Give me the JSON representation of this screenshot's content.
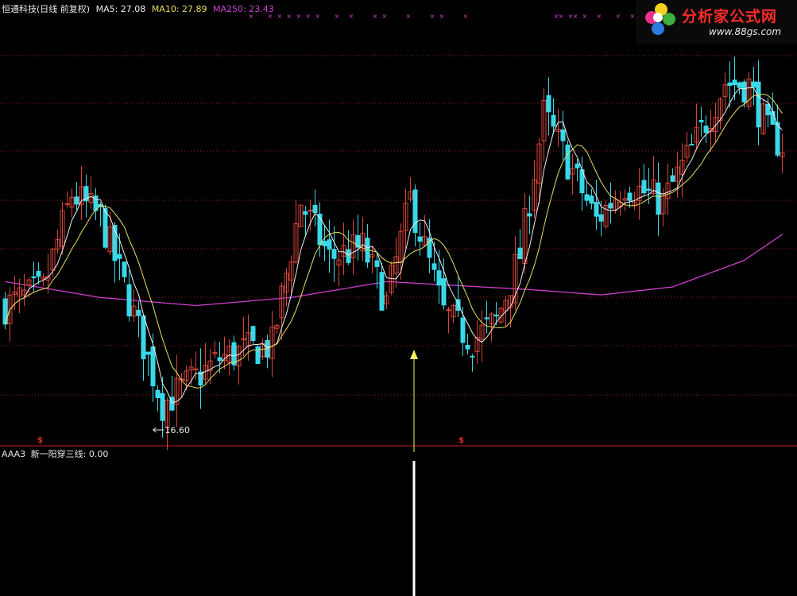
{
  "header": {
    "stock_title": "恒通科技(日线 前复权)",
    "ma5": "MA5: 27.08",
    "ma10": "MA10: 27.89",
    "ma250": "MA250: 23.43"
  },
  "indicator": {
    "name": "AAA3",
    "label": "新一阳穿三线: 0.00"
  },
  "watermark": {
    "brand": "分析家公式网",
    "url": "www.88gs.com"
  },
  "annotations": {
    "low_label": "16.60",
    "marker_glyph": "$"
  },
  "colors": {
    "background": "#000000",
    "up": "#d8453a",
    "down": "#38d8e8",
    "ma5": "#f0f0f0",
    "ma10": "#e8e060",
    "ma250": "#d040d0",
    "grid": "#9a1f1f",
    "title": "#e8e8e8",
    "signal": "#f0f060",
    "topmarks": "#d040d0"
  },
  "chart_data": [
    {
      "type": "candlestick",
      "title": "恒通科技(日线 前复权)",
      "series": [
        {
          "name": "MA5",
          "last": 27.08
        },
        {
          "name": "MA10",
          "last": 27.89
        },
        {
          "name": "MA250",
          "last": 23.43
        }
      ],
      "annotations": [
        {
          "text": "16.60",
          "kind": "period-low"
        }
      ],
      "ylim": [
        15.5,
        31.5
      ],
      "grid": true,
      "candles_approx": 164,
      "price_path_anchors": [
        [
          0,
          20.6
        ],
        [
          8,
          21.2
        ],
        [
          14,
          24.8
        ],
        [
          20,
          23.9
        ],
        [
          26,
          20.8
        ],
        [
          33,
          16.9
        ],
        [
          38,
          17.6
        ],
        [
          45,
          18.6
        ],
        [
          50,
          18.9
        ],
        [
          56,
          19.1
        ],
        [
          62,
          24.5
        ],
        [
          68,
          22.4
        ],
        [
          75,
          22.8
        ],
        [
          80,
          20.7
        ],
        [
          85,
          24.6
        ],
        [
          92,
          20.3
        ],
        [
          98,
          19.3
        ],
        [
          103,
          20.0
        ],
        [
          108,
          22.5
        ],
        [
          113,
          27.8
        ],
        [
          118,
          26.0
        ],
        [
          124,
          23.8
        ],
        [
          130,
          25.2
        ],
        [
          138,
          24.5
        ],
        [
          145,
          26.8
        ],
        [
          151,
          29.0
        ],
        [
          156,
          28.9
        ],
        [
          160,
          27.1
        ],
        [
          164,
          26.5
        ]
      ],
      "ma250_anchors": [
        [
          0,
          21.5
        ],
        [
          20,
          20.9
        ],
        [
          40,
          20.6
        ],
        [
          60,
          20.9
        ],
        [
          80,
          21.5
        ],
        [
          100,
          21.3
        ],
        [
          110,
          21.2
        ],
        [
          125,
          21.0
        ],
        [
          140,
          21.3
        ],
        [
          155,
          22.3
        ],
        [
          164,
          23.4
        ]
      ],
      "signal_index": 86
    },
    {
      "type": "bar",
      "title": "AAA3",
      "series": [
        {
          "name": "新一阳穿三线",
          "last": 0.0
        }
      ],
      "signal_index": 86,
      "signal_value": 1
    }
  ]
}
